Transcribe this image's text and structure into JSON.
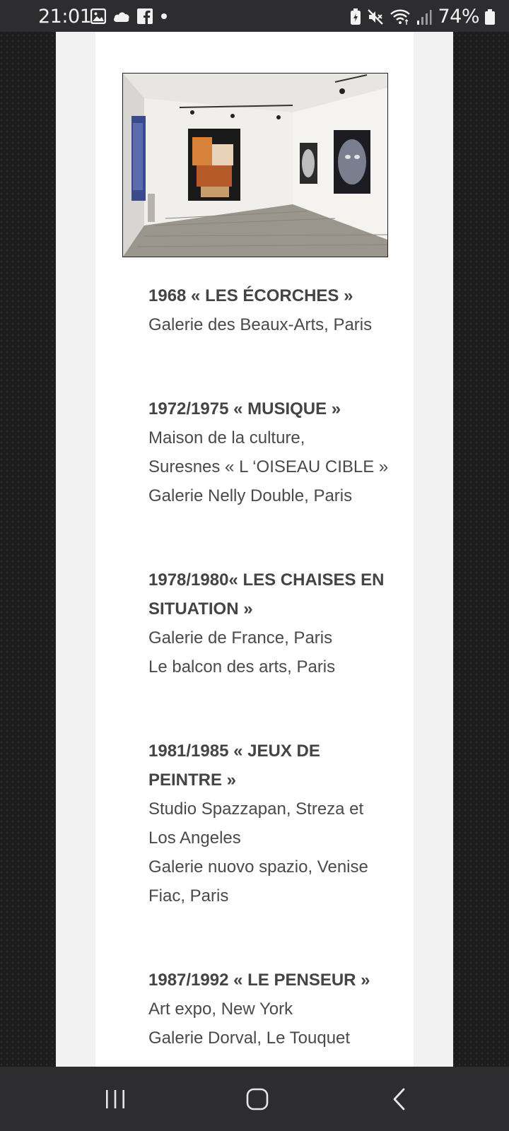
{
  "status_bar": {
    "time": "21:01",
    "battery": "74%",
    "icons_left": [
      "gallery-icon",
      "cloud-icon",
      "facebook-icon",
      "dot-icon"
    ],
    "icons_right": [
      "battery-saver-icon",
      "mute-icon",
      "wifi-icon",
      "signal-icon",
      "battery-icon"
    ]
  },
  "gallery_image": {
    "description_icon": "gallery-room-photo"
  },
  "exhibitions": [
    {
      "title": "1968 « LES ÉCORCHES »",
      "lines": [
        "Galerie des Beaux-Arts, Paris"
      ]
    },
    {
      "title": "1972/1975 « MUSIQUE »",
      "lines": [
        "Maison de la culture,",
        "Suresnes « L ‘OISEAU CIBLE »",
        "Galerie Nelly Double, Paris"
      ]
    },
    {
      "title": "1978/1980« LES CHAISES EN SITUATION »",
      "lines": [
        "Galerie de France, Paris",
        "Le balcon des arts, Paris"
      ]
    },
    {
      "title": "1981/1985 « JEUX DE PEINTRE »",
      "lines": [
        "Studio Spazzapan, Streza et Los Angeles",
        "Galerie nuovo spazio, Venise",
        "Fiac, Paris"
      ]
    },
    {
      "title": "1987/1992 « LE PENSEUR »",
      "lines": [
        "Art expo, New York",
        "Galerie Dorval, Le Touquet"
      ]
    }
  ],
  "nav_bar": {
    "buttons": [
      "recent-apps-icon",
      "home-icon",
      "back-icon"
    ]
  }
}
